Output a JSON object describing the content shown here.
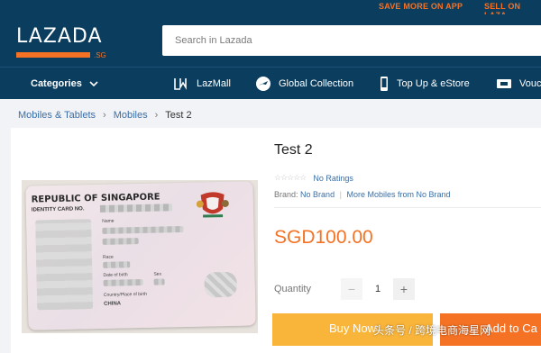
{
  "top_links": {
    "app": "SAVE MORE ON APP",
    "sell": "SELL ON LAZA"
  },
  "logo": {
    "word": "LAZADA",
    "suffix": ".SG"
  },
  "search": {
    "placeholder": "Search in Lazada"
  },
  "nav": {
    "categories": "Categories",
    "items": [
      {
        "label": "LazMall",
        "icon": "lazmall-icon"
      },
      {
        "label": "Global Collection",
        "icon": "globe-plane-icon"
      },
      {
        "label": "Top Up & eStore",
        "icon": "phone-icon"
      },
      {
        "label": "Vouc",
        "icon": "voucher-icon"
      }
    ]
  },
  "breadcrumb": [
    "Mobiles & Tablets",
    "Mobiles",
    "Test 2"
  ],
  "id_card": {
    "line1": "REPUBLIC OF SINGAPORE",
    "line2": "IDENTITY CARD NO.",
    "fields": [
      "Name",
      "Race",
      "Date of birth",
      "Sex",
      "Country/Place of birth"
    ],
    "country": "CHINA"
  },
  "product": {
    "title": "Test 2",
    "rating_text": "No Ratings",
    "brand_label": "Brand:",
    "brand_value": "No Brand",
    "more_from": "More Mobiles from No Brand",
    "price": "SGD100.00",
    "quantity_label": "Quantity",
    "quantity_value": "1",
    "minus": "−",
    "plus": "+",
    "buy_now": "Buy Now",
    "add_to_cart": "Add to Ca"
  },
  "watermark": "头条号 / 跨境电商海星网",
  "colors": {
    "header": "#0b3d5e",
    "accent": "#f57224",
    "buy": "#f9b43a",
    "link": "#3b6ea5"
  }
}
